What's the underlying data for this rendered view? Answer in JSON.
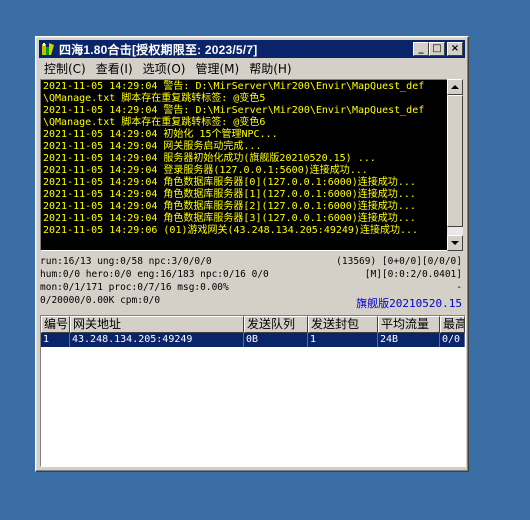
{
  "window": {
    "title": "四海1.80合击[授权期限至: 2023/5/7]",
    "buttons": {
      "minimize": "_",
      "maximize": "□",
      "close": "×"
    }
  },
  "menu": [
    "控制(C)",
    "查看(I)",
    "选项(O)",
    "管理(M)",
    "帮助(H)"
  ],
  "log": [
    "2021-11-05 14:29:04 警告: D:\\MirServer\\Mir200\\Envir\\MapQuest_def",
    "\\QManage.txt 脚本存在重复跳转标签: @变色5",
    "2021-11-05 14:29:04 警告: D:\\MirServer\\Mir200\\Envir\\MapQuest_def",
    "\\QManage.txt 脚本存在重复跳转标签: @变色6",
    "2021-11-05 14:29:04 初始化 15个管理NPC...",
    "2021-11-05 14:29:04 网关服务启动完成...",
    "2021-11-05 14:29:04 服务器初始化成功(旗舰版20210520.15) ...",
    "2021-11-05 14:29:04 登录服务器(127.0.0.1:5600)连接成功...",
    "2021-11-05 14:29:04 角色数据库服务器[0](127.0.0.1:6000)连接成功...",
    "2021-11-05 14:29:04 角色数据库服务器[1](127.0.0.1:6000)连接成功...",
    "2021-11-05 14:29:04 角色数据库服务器[2](127.0.0.1:6000)连接成功...",
    "2021-11-05 14:29:04 角色数据库服务器[3](127.0.0.1:6000)连接成功...",
    "2021-11-05 14:29:06 (01)游戏网关(43.248.134.205:49249)连接成功..."
  ],
  "status": {
    "row1_left": "run:16/13 ung:0/58 npc:3/0/0/0",
    "row1_right": "(13569) [0+0/0][0/0/0]",
    "row2_left": "hum:0/0 hero:0/0 eng:16/183 npc:0/16 0/0",
    "row2_right": "[M][0:0:2/0.0401]",
    "row3_left": "mon:0/1/171 proc:0/7/16 msg:0.00%",
    "row3_right": "-",
    "row4_left": "0/20000/0.00K cpm:0/0",
    "row4_right": "旗舰版20210520.15"
  },
  "table": {
    "headers": [
      "编号",
      "网关地址",
      "发送队列",
      "发送封包",
      "平均流量",
      "最高"
    ],
    "rows": [
      [
        "1",
        "43.248.134.205:49249",
        "0B",
        "1",
        "24B",
        "0/0"
      ]
    ]
  }
}
